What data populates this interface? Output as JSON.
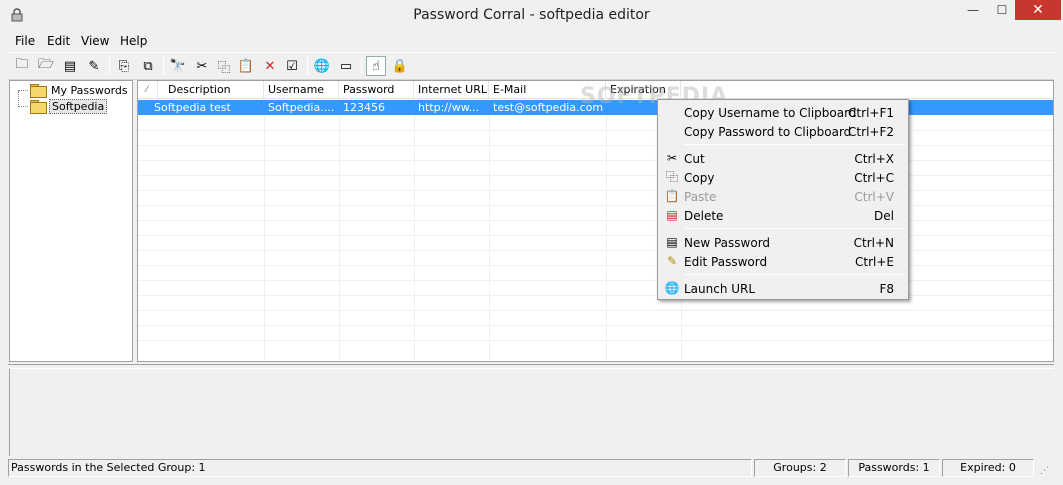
{
  "window": {
    "title": "Password Corral - softpedia editor",
    "min_symbol": "—",
    "max_symbol": "☐",
    "close_symbol": "✕"
  },
  "menu": [
    "File",
    "Edit",
    "View",
    "Help"
  ],
  "toolbar": [
    {
      "icon": "new-group-icon",
      "glyph": "🗀"
    },
    {
      "icon": "edit-group-icon",
      "glyph": "🗁"
    },
    {
      "icon": "new-password-icon",
      "glyph": "▤"
    },
    {
      "icon": "edit-password-icon",
      "glyph": "✎"
    },
    {
      "icon": "copy-username-icon",
      "glyph": "⎘"
    },
    {
      "icon": "copy-password-icon",
      "glyph": "⧉"
    },
    {
      "icon": "find-icon",
      "glyph": "🔭"
    },
    {
      "icon": "cut-icon",
      "glyph": "✂"
    },
    {
      "icon": "copy-icon",
      "glyph": "⿻"
    },
    {
      "icon": "paste-icon",
      "glyph": "📋"
    },
    {
      "icon": "delete-icon",
      "glyph": "✕"
    },
    {
      "icon": "properties-icon",
      "glyph": "☑"
    },
    {
      "icon": "launch-url-icon",
      "glyph": "🌐"
    },
    {
      "icon": "window-icon",
      "glyph": "▭"
    },
    {
      "icon": "autotype-icon",
      "glyph": "☝"
    },
    {
      "icon": "lock-icon",
      "glyph": "🔒"
    }
  ],
  "tree": {
    "items": [
      {
        "label": "My Passwords",
        "selected": false
      },
      {
        "label": "Softpedia",
        "selected": true
      }
    ]
  },
  "list": {
    "sort_mark": "⁄",
    "columns": [
      "Description",
      "Username",
      "Password",
      "Internet URL",
      "E-Mail",
      "Expiration"
    ],
    "rows": [
      [
        "Softpedia test",
        "Softpedia....",
        "123456",
        "http://ww...",
        "test@softpedia.com",
        ""
      ]
    ]
  },
  "watermark": "SOFTPEDIA",
  "context_menu": {
    "items": [
      {
        "label": "Copy Username to Clipboard",
        "shortcut": "Ctrl+F1",
        "icon": "",
        "glyph": "",
        "disabled": false
      },
      {
        "label": "Copy Password to Clipboard",
        "shortcut": "Ctrl+F2",
        "icon": "",
        "glyph": "",
        "disabled": false
      },
      {
        "label": "Cut",
        "shortcut": "Ctrl+X",
        "icon": "cut-icon",
        "glyph": "✂",
        "disabled": false
      },
      {
        "label": "Copy",
        "shortcut": "Ctrl+C",
        "icon": "copy-icon",
        "glyph": "⿻",
        "disabled": false
      },
      {
        "label": "Paste",
        "shortcut": "Ctrl+V",
        "icon": "paste-icon",
        "glyph": "📋",
        "disabled": true
      },
      {
        "label": "Delete",
        "shortcut": "Del",
        "icon": "delete-icon",
        "glyph": "▤",
        "disabled": false
      },
      {
        "label": "New Password",
        "shortcut": "Ctrl+N",
        "icon": "new-password-icon",
        "glyph": "▤",
        "disabled": false
      },
      {
        "label": "Edit Password",
        "shortcut": "Ctrl+E",
        "icon": "edit-password-icon",
        "glyph": "✎",
        "disabled": false
      },
      {
        "label": "Launch URL",
        "shortcut": "F8",
        "icon": "launch-url-icon",
        "glyph": "🌐",
        "disabled": false
      }
    ]
  },
  "status": {
    "main": "Passwords in the Selected Group: 1",
    "groups": "Groups: 2",
    "passwords": "Passwords: 1",
    "expired": "Expired: 0"
  },
  "colors": {
    "selection": "#3399ff",
    "close_button": "#c7372f"
  }
}
